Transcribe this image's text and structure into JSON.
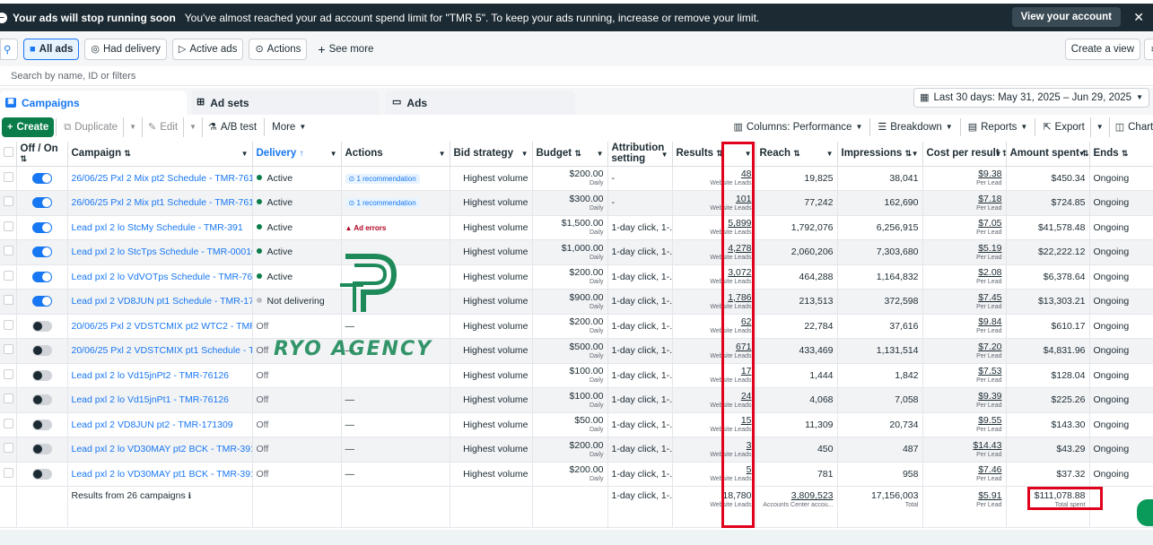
{
  "banner": {
    "title": "Your ads will stop running soon",
    "message": "You've almost reached your ad account spend limit for \"TMR 5\". To keep your ads running, increase or remove your limit.",
    "view_label": "View your account",
    "close_icon": "close-icon"
  },
  "filters": {
    "all_ads": "All ads",
    "had_delivery": "Had delivery",
    "active_ads": "Active ads",
    "actions": "Actions",
    "see_more": "See more",
    "create_view": "Create a view"
  },
  "search": {
    "placeholder": "Search by name, ID or filters"
  },
  "tabs": {
    "campaigns": "Campaigns",
    "ad_sets": "Ad sets",
    "ads": "Ads"
  },
  "date_range": "Last 30 days: May 31, 2025 – Jun 29, 2025",
  "toolbar": {
    "create": "Create",
    "duplicate": "Duplicate",
    "edit": "Edit",
    "ab_test": "A/B test",
    "more": "More",
    "columns": "Columns: Performance",
    "breakdown": "Breakdown",
    "reports": "Reports",
    "export": "Export",
    "charts": "Charts"
  },
  "columns": {
    "offon": "Off / On",
    "campaign": "Campaign",
    "delivery": "Delivery",
    "actions": "Actions",
    "bid": "Bid strategy",
    "budget": "Budget",
    "attribution": "Attribution setting",
    "results": "Results",
    "reach": "Reach",
    "impressions": "Impressions",
    "cpr": "Cost per result",
    "spent": "Amount spent",
    "ends": "Ends"
  },
  "rows": [
    {
      "on": true,
      "campaign": "26/06/25 Pxl 2 Mix pt2 Schedule - TMR-76126",
      "delivery": "Active",
      "action": "1 recommendation",
      "bid": "Highest volume",
      "budget": "$200.00",
      "budget_sub": "Daily",
      "attribution": "-",
      "results": "48",
      "results_sub": "Website Leads",
      "reach": "19,825",
      "impressions": "38,041",
      "cpr": "$9.38",
      "cpr_sub": "Per Lead",
      "spent": "$450.34",
      "ends": "Ongoing"
    },
    {
      "on": true,
      "campaign": "26/06/25 Pxl 2 Mix pt1 Schedule - TMR-76126",
      "delivery": "Active",
      "action": "1 recommendation",
      "bid": "Highest volume",
      "budget": "$300.00",
      "budget_sub": "Daily",
      "attribution": "-",
      "results": "101",
      "results_sub": "Website Leads",
      "reach": "77,242",
      "impressions": "162,690",
      "cpr": "$7.18",
      "cpr_sub": "Per Lead",
      "spent": "$724.85",
      "ends": "Ongoing"
    },
    {
      "on": true,
      "campaign": "Lead pxl 2 lo StcMy Schedule - TMR-391",
      "delivery": "Active",
      "action": "Ad errors",
      "bid": "Highest volume",
      "budget": "$1,500.00",
      "budget_sub": "Daily",
      "attribution": "1-day click, 1-...",
      "results": "5,899",
      "results_sub": "Website Leads",
      "reach": "1,792,076",
      "impressions": "6,256,915",
      "cpr": "$7.05",
      "cpr_sub": "Per Lead",
      "spent": "$41,578.48",
      "ends": "Ongoing"
    },
    {
      "on": true,
      "campaign": "Lead pxl 2 lo StcTps Schedule - TMR-00010",
      "delivery": "Active",
      "action": "",
      "bid": "Highest volume",
      "budget": "$1,000.00",
      "budget_sub": "Daily",
      "attribution": "1-day click, 1-...",
      "results": "4,278",
      "results_sub": "Website Leads",
      "reach": "2,060,206",
      "impressions": "7,303,680",
      "cpr": "$5.19",
      "cpr_sub": "Per Lead",
      "spent": "$22,222.12",
      "ends": "Ongoing"
    },
    {
      "on": true,
      "campaign": "Lead pxl 2 lo VdVOTps Schedule - TMR-76126",
      "delivery": "Active",
      "action": "",
      "bid": "Highest volume",
      "budget": "$200.00",
      "budget_sub": "Daily",
      "attribution": "1-day click, 1-...",
      "results": "3,072",
      "results_sub": "Website Leads",
      "reach": "464,288",
      "impressions": "1,164,832",
      "cpr": "$2.08",
      "cpr_sub": "Per Lead",
      "spent": "$6,378.64",
      "ends": "Ongoing"
    },
    {
      "on": true,
      "campaign": "Lead pxl 2 VD8JUN pt1 Schedule - TMR-171309",
      "delivery": "Not delivering",
      "action": "",
      "bid": "Highest volume",
      "budget": "$900.00",
      "budget_sub": "Daily",
      "attribution": "1-day click, 1-...",
      "results": "1,786",
      "results_sub": "Website Leads",
      "reach": "213,513",
      "impressions": "372,598",
      "cpr": "$7.45",
      "cpr_sub": "Per Lead",
      "spent": "$13,303.21",
      "ends": "Ongoing"
    },
    {
      "on": false,
      "campaign": "20/06/25 Pxl 2 VDSTCMIX pt2 WTC2 - TMR-76126",
      "delivery": "Off",
      "action": "—",
      "bid": "Highest volume",
      "budget": "$200.00",
      "budget_sub": "Daily",
      "attribution": "1-day click, 1-...",
      "results": "62",
      "results_sub": "Website Leads",
      "reach": "22,784",
      "impressions": "37,616",
      "cpr": "$9.84",
      "cpr_sub": "Per Lead",
      "spent": "$610.17",
      "ends": "Ongoing"
    },
    {
      "on": false,
      "campaign": "20/06/25 Pxl 2 VDSTCMIX pt1 Schedule - TMR-761...",
      "delivery": "Off",
      "action": "—",
      "bid": "Highest volume",
      "budget": "$500.00",
      "budget_sub": "Daily",
      "attribution": "1-day click, 1-...",
      "results": "671",
      "results_sub": "Website Leads",
      "reach": "433,469",
      "impressions": "1,131,514",
      "cpr": "$7.20",
      "cpr_sub": "Per Lead",
      "spent": "$4,831.96",
      "ends": "Ongoing"
    },
    {
      "on": false,
      "campaign": "Lead pxl 2 lo Vd15jnPt2 - TMR-76126",
      "delivery": "Off",
      "action": "",
      "bid": "Highest volume",
      "budget": "$100.00",
      "budget_sub": "Daily",
      "attribution": "1-day click, 1-...",
      "results": "17",
      "results_sub": "Website Leads",
      "reach": "1,444",
      "impressions": "1,842",
      "cpr": "$7.53",
      "cpr_sub": "Per Lead",
      "spent": "$128.04",
      "ends": "Ongoing"
    },
    {
      "on": false,
      "campaign": "Lead pxl 2 lo Vd15jnPt1 - TMR-76126",
      "delivery": "Off",
      "action": "—",
      "bid": "Highest volume",
      "budget": "$100.00",
      "budget_sub": "Daily",
      "attribution": "1-day click, 1-...",
      "results": "24",
      "results_sub": "Website Leads",
      "reach": "4,068",
      "impressions": "7,058",
      "cpr": "$9.39",
      "cpr_sub": "Per Lead",
      "spent": "$225.26",
      "ends": "Ongoing"
    },
    {
      "on": false,
      "campaign": "Lead pxl 2 VD8JUN pt2 - TMR-171309",
      "delivery": "Off",
      "action": "—",
      "bid": "Highest volume",
      "budget": "$50.00",
      "budget_sub": "Daily",
      "attribution": "1-day click, 1-...",
      "results": "15",
      "results_sub": "Website Leads",
      "reach": "11,309",
      "impressions": "20,734",
      "cpr": "$9.55",
      "cpr_sub": "Per Lead",
      "spent": "$143.30",
      "ends": "Ongoing"
    },
    {
      "on": false,
      "campaign": "Lead pxl 2 lo VD30MAY pt2 BCK - TMR-391",
      "delivery": "Off",
      "action": "—",
      "bid": "Highest volume",
      "budget": "$200.00",
      "budget_sub": "Daily",
      "attribution": "1-day click, 1-...",
      "results": "3",
      "results_sub": "Website Leads",
      "reach": "450",
      "impressions": "487",
      "cpr": "$14.43",
      "cpr_sub": "Per Lead",
      "spent": "$43.29",
      "ends": "Ongoing"
    },
    {
      "on": false,
      "campaign": "Lead pxl 2 lo VD30MAY pt1 BCK - TMR-391",
      "delivery": "Off",
      "action": "—",
      "bid": "Highest volume",
      "budget": "$200.00",
      "budget_sub": "Daily",
      "attribution": "1-day click, 1-...",
      "results": "5",
      "results_sub": "Website Leads",
      "reach": "781",
      "impressions": "958",
      "cpr": "$7.46",
      "cpr_sub": "Per Lead",
      "spent": "$37.32",
      "ends": "Ongoing"
    }
  ],
  "totals": {
    "label": "Results from 26 campaigns",
    "attribution": "1-day click, 1-...",
    "results": "18,780",
    "results_sub": "Website Leads",
    "reach": "3,809,523",
    "reach_sub": "Accounts Center accou...",
    "impressions": "17,156,003",
    "impressions_sub": "Total",
    "cpr": "$5.91",
    "cpr_sub": "Per Lead",
    "spent": "$111,078.88",
    "spent_sub": "Total spent"
  },
  "watermark": "RYO AGENCY",
  "colors": {
    "accent": "#1877f2",
    "active": "#0a7d4a",
    "highlight": "#e0001b",
    "dark_banner": "#1c2b33"
  }
}
